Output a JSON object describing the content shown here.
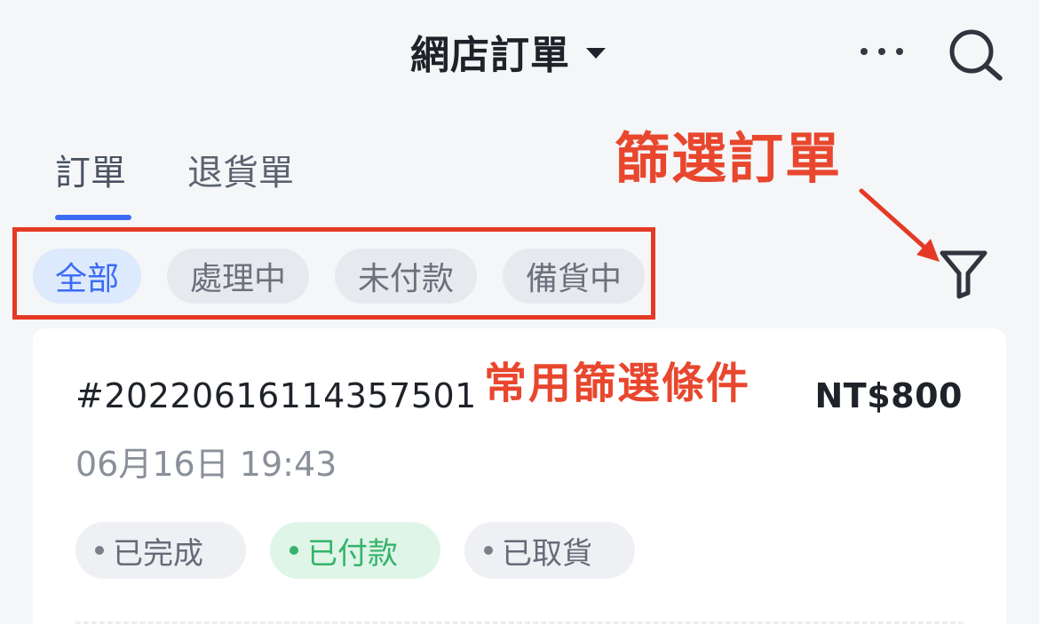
{
  "header": {
    "title": "網店訂單",
    "more_icon": "more-horizontal-icon",
    "search_icon": "search-icon"
  },
  "tabs": [
    {
      "label": "訂單",
      "active": true
    },
    {
      "label": "退貨單",
      "active": false
    }
  ],
  "filter_chips": [
    {
      "label": "全部",
      "active": true
    },
    {
      "label": "處理中",
      "active": false
    },
    {
      "label": "未付款",
      "active": false
    },
    {
      "label": "備貨中",
      "active": false
    }
  ],
  "filter_icon": "funnel-icon",
  "annotations": {
    "filter_orders": "篩選訂單",
    "common_filters": "常用篩選條件",
    "color": "#e8472e"
  },
  "order": {
    "number": "#20220616114357501",
    "amount": "NT$800",
    "time": "06月16日 19:43",
    "statuses": [
      {
        "label": "已完成",
        "tone": "gray"
      },
      {
        "label": "已付款",
        "tone": "green"
      },
      {
        "label": "已取貨",
        "tone": "gray"
      }
    ]
  },
  "colors": {
    "accent": "#3b6cf5",
    "paid_green": "#36b36a",
    "annotation_red": "#e43a25",
    "background": "#f5f6f8"
  }
}
